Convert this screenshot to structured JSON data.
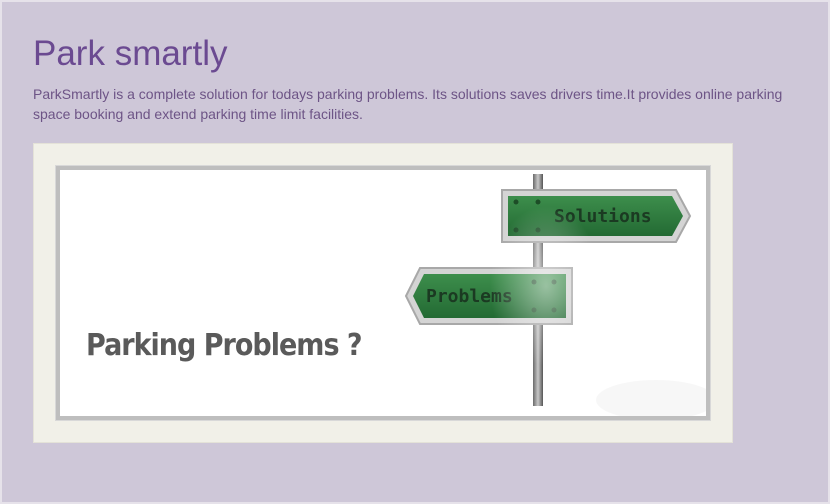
{
  "page": {
    "title": "Park smartly",
    "description": "ParkSmartly is a complete solution for todays parking problems. Its solutions saves drivers time.It provides online parking space booking and extend parking time limit facilities."
  },
  "banner": {
    "caption": "Parking Problems ?",
    "sign_top": "Solutions",
    "sign_bottom": "Problems"
  },
  "colors": {
    "background": "#cec7d8",
    "title": "#6b4a91",
    "text": "#6d5486",
    "sign_green": "#2f7a3f"
  }
}
